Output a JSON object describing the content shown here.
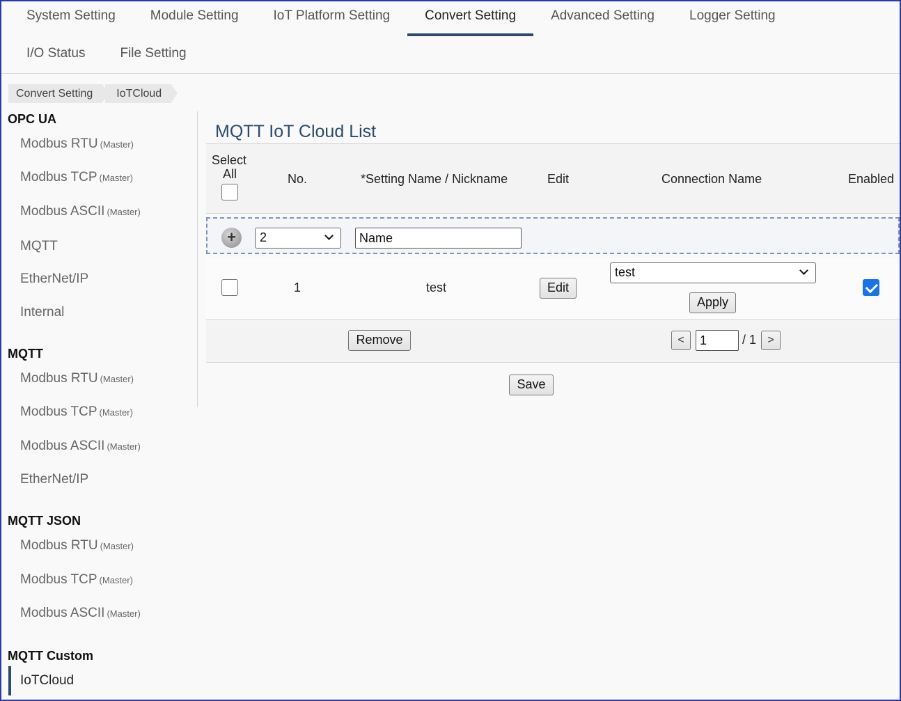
{
  "nav": {
    "row1": [
      "System Setting",
      "Module Setting",
      "IoT Platform Setting",
      "Convert Setting",
      "Advanced Setting",
      "Logger Setting"
    ],
    "row2": [
      "I/O Status",
      "File Setting"
    ],
    "active": "Convert Setting"
  },
  "breadcrumb": [
    "Convert Setting",
    "IoTCloud"
  ],
  "sidebar": {
    "groups": [
      {
        "title": "OPC UA",
        "items": [
          {
            "label": "Modbus RTU",
            "sub": "(Master)"
          },
          {
            "label": "Modbus TCP",
            "sub": "(Master)"
          },
          {
            "label": "Modbus ASCII",
            "sub": "(Master)"
          },
          {
            "label": "MQTT",
            "sub": ""
          },
          {
            "label": "EtherNet/IP",
            "sub": ""
          },
          {
            "label": "Internal",
            "sub": ""
          }
        ]
      },
      {
        "title": "MQTT",
        "items": [
          {
            "label": "Modbus RTU",
            "sub": "(Master)"
          },
          {
            "label": "Modbus TCP",
            "sub": "(Master)"
          },
          {
            "label": "Modbus ASCII",
            "sub": "(Master)"
          },
          {
            "label": "EtherNet/IP",
            "sub": ""
          }
        ]
      },
      {
        "title": "MQTT JSON",
        "items": [
          {
            "label": "Modbus RTU",
            "sub": "(Master)"
          },
          {
            "label": "Modbus TCP",
            "sub": "(Master)"
          },
          {
            "label": "Modbus ASCII",
            "sub": "(Master)"
          }
        ]
      },
      {
        "title": "MQTT Custom",
        "items": [
          {
            "label": "IoTCloud",
            "sub": ""
          }
        ]
      }
    ],
    "selected": "IoTCloud"
  },
  "main": {
    "title": "MQTT IoT Cloud List",
    "headers": {
      "select": "Select",
      "all": "All",
      "no": "No.",
      "name": "*Setting Name / Nickname",
      "edit": "Edit",
      "connection": "Connection Name",
      "enabled": "Enabled"
    },
    "add_row": {
      "count_value": "2",
      "name_value": "Name"
    },
    "rows": [
      {
        "no": "1",
        "name": "test",
        "edit_label": "Edit",
        "connection": "test",
        "apply_label": "Apply",
        "enabled": true
      }
    ],
    "remove_label": "Remove",
    "pager": {
      "prev": "<",
      "page": "1",
      "total": "/ 1",
      "next": ">"
    },
    "save_label": "Save"
  }
}
